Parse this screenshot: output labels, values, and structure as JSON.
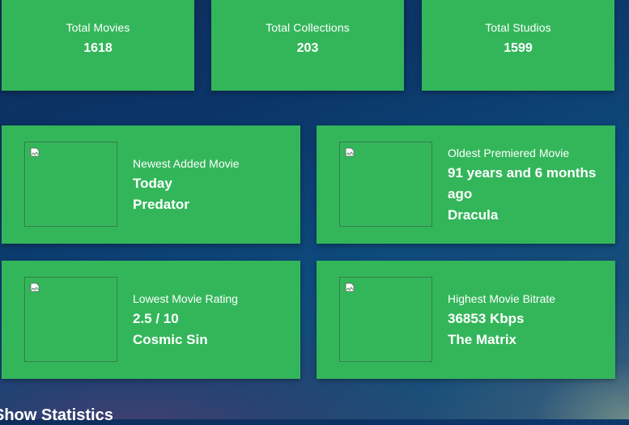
{
  "stats": [
    {
      "label": "Total Movies",
      "value": "1618"
    },
    {
      "label": "Total Collections",
      "value": "203"
    },
    {
      "label": "Total Studios",
      "value": "1599"
    }
  ],
  "movies": [
    {
      "label": "Newest Added Movie",
      "line1": "Today",
      "line2": "Predator"
    },
    {
      "label": "Oldest Premiered Movie",
      "line1": "91 years and 6 months ago",
      "line2": "Dracula"
    },
    {
      "label": "Lowest Movie Rating",
      "line1": "2.5 / 10",
      "line2": "Cosmic Sin"
    },
    {
      "label": "Highest Movie Bitrate",
      "line1": "36853 Kbps",
      "line2": "The Matrix"
    }
  ],
  "section": {
    "heading": "Show Statistics"
  },
  "colors": {
    "card": "#33b65a",
    "text": "#ffffff"
  },
  "icons": {
    "poster_placeholder": "broken-image-icon"
  }
}
